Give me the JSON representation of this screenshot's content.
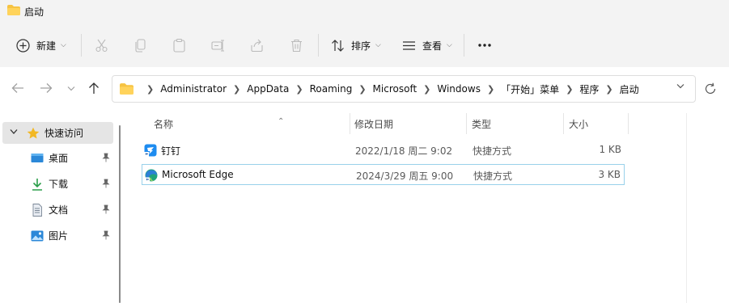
{
  "window": {
    "title": "启动"
  },
  "toolbar": {
    "new_label": "新建",
    "sort_label": "排序",
    "view_label": "查看",
    "more_label": "•••"
  },
  "address": {
    "crumbs": [
      "Administrator",
      "AppData",
      "Roaming",
      "Microsoft",
      "Windows",
      "「开始」菜单",
      "程序",
      "启动"
    ]
  },
  "sidebar": {
    "quick_access": "快速访问",
    "items": [
      {
        "label": "桌面",
        "icon": "desktop-icon"
      },
      {
        "label": "下载",
        "icon": "download-icon"
      },
      {
        "label": "文档",
        "icon": "document-icon"
      },
      {
        "label": "图片",
        "icon": "picture-icon"
      }
    ]
  },
  "columns": {
    "name": "名称",
    "date": "修改日期",
    "type": "类型",
    "size": "大小"
  },
  "files": [
    {
      "name": "钉钉",
      "date": "2022/1/18 周二 9:02",
      "type": "快捷方式",
      "size": "1 KB",
      "icon": "dingtalk-icon"
    },
    {
      "name": "Microsoft Edge",
      "date": "2024/3/29 周五 9:00",
      "type": "快捷方式",
      "size": "3 KB",
      "icon": "edge-icon"
    }
  ],
  "colors": {
    "accent": "#0067c0",
    "folder": "#f6c342",
    "selection_border": "#99d1ea",
    "hover": "#e5e5e5"
  }
}
